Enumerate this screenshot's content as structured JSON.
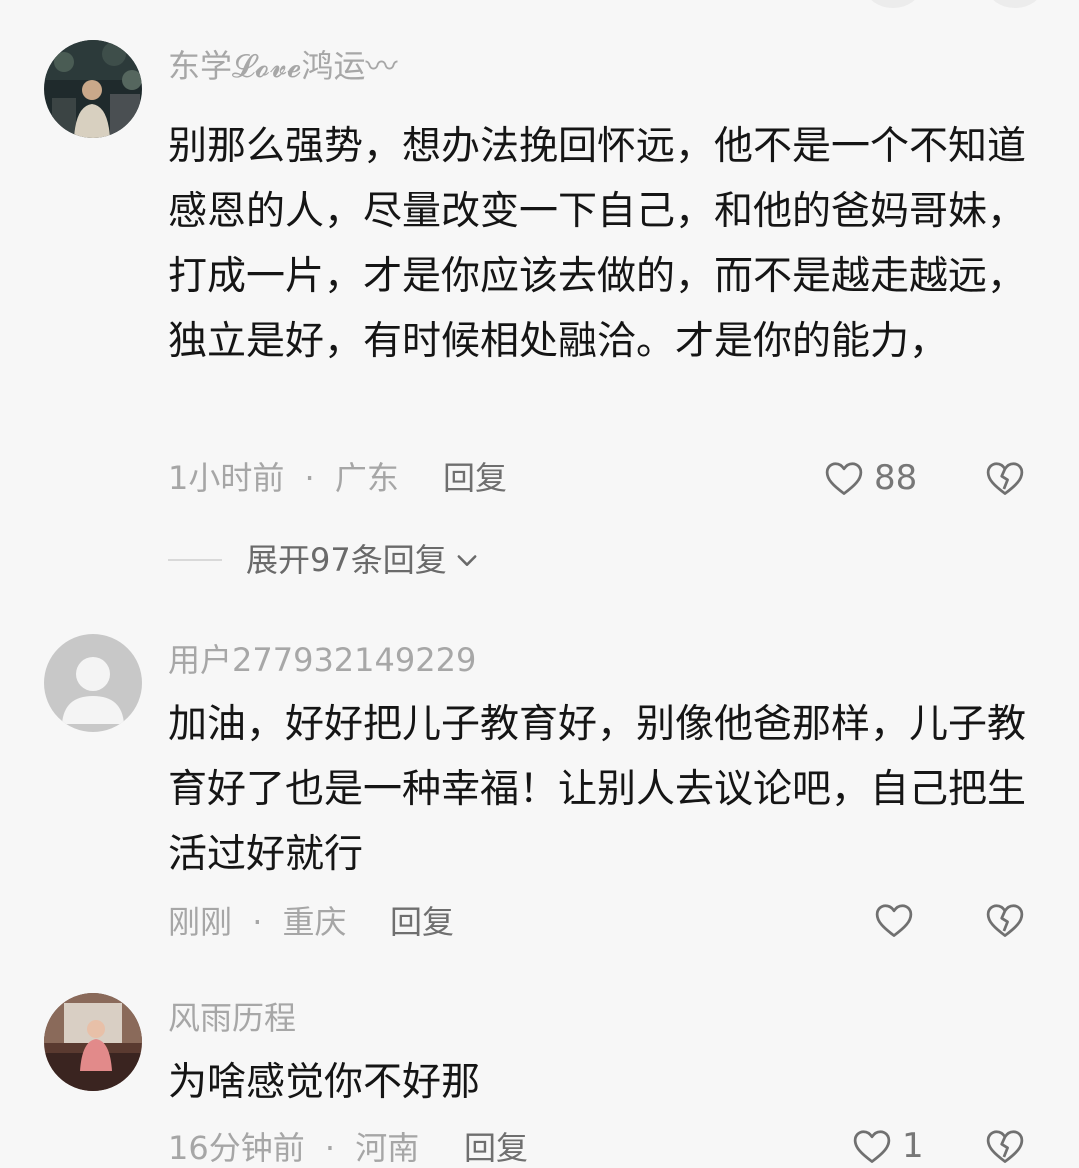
{
  "comments": [
    {
      "username": "东学𝓛𝓸𝓿𝓮鸿运〰",
      "avatar": "photo-avatar-dark",
      "text": "别那么强势，想办法挽回怀远，他不是一个不知道感恩的人，尽量改变一下自己，和他的爸妈哥妹，打成一片，才是你应该去做的，而不是越走越远，独立是好，有时候相处融洽。才是你的能力，",
      "time": "1小时前",
      "separator": "·",
      "location": "广东",
      "reply_label": "回复",
      "likes": "88",
      "expand_label": "展开97条回复"
    },
    {
      "username": "用户277932149229",
      "avatar": "default-user-icon",
      "text": "加油，好好把儿子教育好，别像他爸那样，儿子教育好了也是一种幸福！让别人去议论吧，自己把生活过好就行",
      "time": "刚刚",
      "separator": "·",
      "location": "重庆",
      "reply_label": "回复",
      "likes": ""
    },
    {
      "username": "风雨历程",
      "avatar": "photo-avatar-room",
      "text": "为啥感觉你不好那",
      "time": "16分钟前",
      "separator": "·",
      "location": "河南",
      "reply_label": "回复",
      "likes": "1"
    }
  ],
  "icons": {
    "like": "heart-outline-icon",
    "dislike": "broken-heart-icon",
    "expand": "chevron-down-icon"
  },
  "colors": {
    "background": "#f7f7f7",
    "username": "#a7a7a7",
    "body": "#151515",
    "meta": "#a6a6a6",
    "action": "#6f6f6f"
  }
}
